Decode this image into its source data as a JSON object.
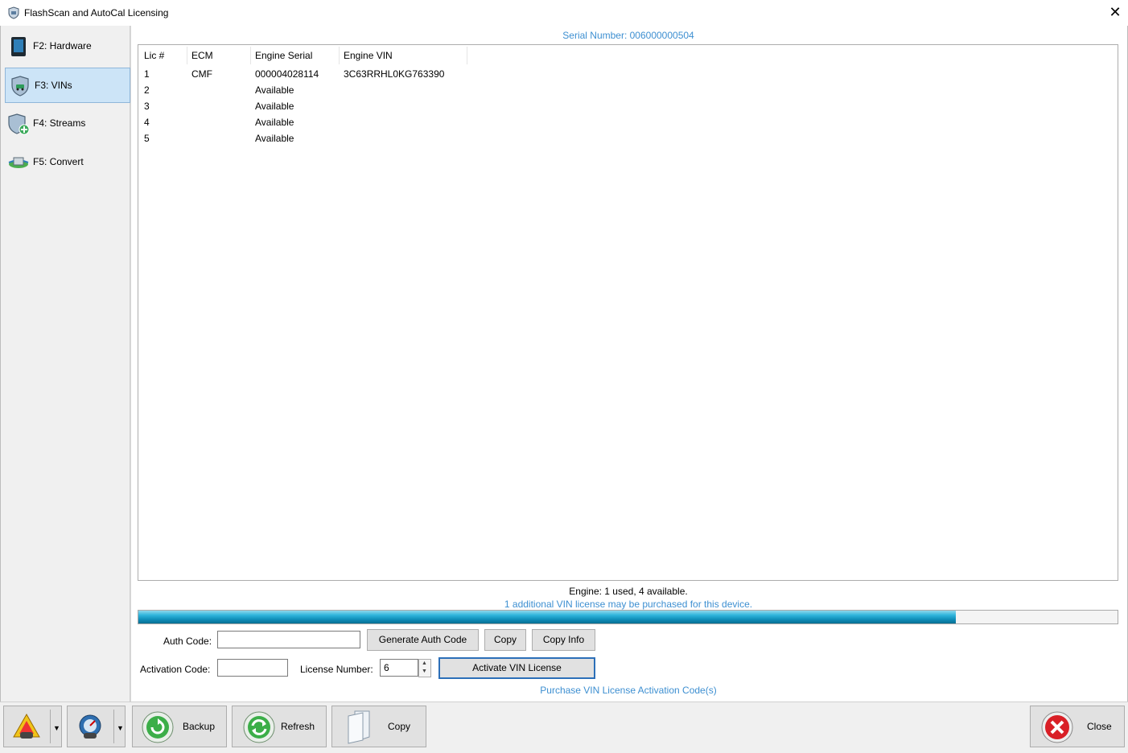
{
  "window": {
    "title": "FlashScan and AutoCal Licensing",
    "close_glyph": "✕"
  },
  "sidebar": {
    "items": [
      {
        "label": "F2: Hardware",
        "icon": "tablet-icon"
      },
      {
        "label": "F3: VINs",
        "icon": "shield-car-icon",
        "selected": true
      },
      {
        "label": "F4: Streams",
        "icon": "shield-add-icon"
      },
      {
        "label": "F5: Convert",
        "icon": "convert-icon"
      }
    ]
  },
  "main": {
    "serial": "Serial Number: 006000000504",
    "table": {
      "columns": [
        "Lic #",
        "ECM",
        "Engine Serial",
        "Engine VIN"
      ],
      "rows": [
        {
          "lic": "1",
          "ecm": "CMF",
          "serial": "000004028114",
          "vin": "3C63RRHL0KG763390"
        },
        {
          "lic": "2",
          "ecm": "",
          "serial": "Available",
          "vin": ""
        },
        {
          "lic": "3",
          "ecm": "",
          "serial": "Available",
          "vin": ""
        },
        {
          "lic": "4",
          "ecm": "",
          "serial": "Available",
          "vin": ""
        },
        {
          "lic": "5",
          "ecm": "",
          "serial": "Available",
          "vin": ""
        }
      ]
    },
    "summary": "Engine: 1 used, 4 available.",
    "purchase_note": "1 additional VIN license may be purchased for this device.",
    "progress_fraction": 0.835,
    "colors": {
      "accent_text": "#3d8fd1",
      "selected_bg": "#cce4f7",
      "progress": "#0e8cb7"
    },
    "auth": {
      "label": "Auth Code:",
      "value": "",
      "generate_label": "Generate Auth Code",
      "copy_label": "Copy",
      "copy_info_label": "Copy Info"
    },
    "activation": {
      "label": "Activation Code:",
      "value": "",
      "license_label": "License Number:",
      "license_value": "6",
      "activate_label": "Activate VIN License"
    },
    "purchase_link": "Purchase VIN License Activation Code(s)"
  },
  "toolbar": {
    "backup_label": "Backup",
    "refresh_label": "Refresh",
    "copy_label": "Copy",
    "close_label": "Close"
  }
}
